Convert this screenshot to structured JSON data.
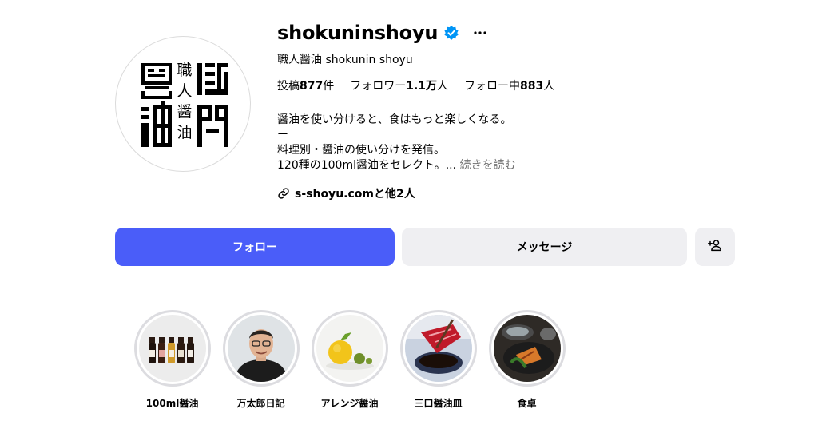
{
  "profile": {
    "username": "shokuninshoyu",
    "full_name": "職人醤油 shokunin shoyu",
    "logo_text": "職人醤油"
  },
  "stats": {
    "posts_label": "投稿",
    "posts_count": "877",
    "posts_unit": "件",
    "followers_label": "フォロワー",
    "followers_count": "1.1万",
    "followers_unit": "人",
    "following_label": "フォロー中",
    "following_count": "883",
    "following_unit": "人"
  },
  "bio": {
    "line1": "醤油を使い分けると、食はもっと楽しくなる。",
    "line2": "ー",
    "line3": "料理別・醤油の使い分けを発信。",
    "line4": "120種の100ml醤油をセレクト。...",
    "more": "続きを読む"
  },
  "link": {
    "text": "s-shoyu.comと他2人"
  },
  "buttons": {
    "follow": "フォロー",
    "message": "メッセージ"
  },
  "highlights": [
    {
      "label": "100ml醤油",
      "image": "soy-sauce-bottles"
    },
    {
      "label": "万太郎日記",
      "image": "man-portrait"
    },
    {
      "label": "アレンジ醤油",
      "image": "citrus-fruits"
    },
    {
      "label": "三口醤油皿",
      "image": "sashimi-dish"
    },
    {
      "label": "食卓",
      "image": "dining-table"
    }
  ],
  "colors": {
    "primary": "#4a5df9",
    "secondary_button": "#efeff2",
    "verified": "#0095f6",
    "muted_text": "#737373"
  },
  "icons": {
    "verified": "verified-badge-icon",
    "more": "more-horizontal-icon",
    "link": "link-icon",
    "add_user": "add-user-icon"
  }
}
